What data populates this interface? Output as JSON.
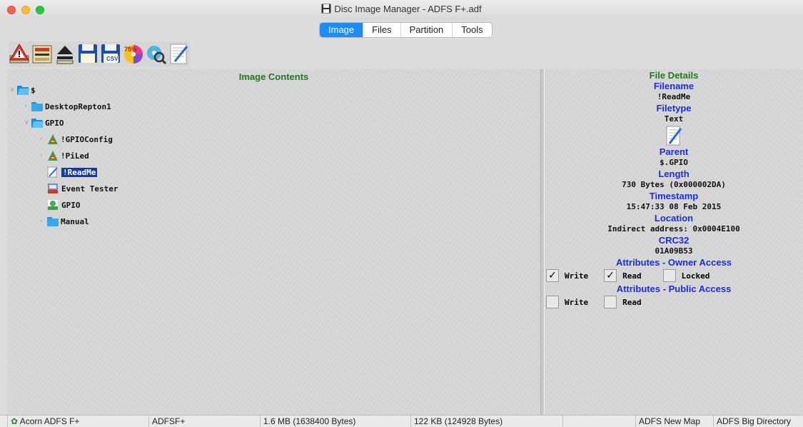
{
  "window": {
    "title": "Disc Image Manager - ADFS F+.adf"
  },
  "tabs": [
    {
      "label": "Image",
      "active": true
    },
    {
      "label": "Files",
      "active": false
    },
    {
      "label": "Partition",
      "active": false
    },
    {
      "label": "Tools",
      "active": false
    }
  ],
  "toolbar": {
    "icons": [
      "warning-disc-icon",
      "floppy-drive-icon",
      "eject-icon",
      "save-icon",
      "save-csv-icon",
      "disc-75-percent-icon",
      "disc-search-icon",
      "text-file-icon"
    ],
    "csv_badge": "CSV",
    "percent_badge": "75%"
  },
  "image_contents": {
    "title": "Image Contents",
    "tree": [
      {
        "label": "$",
        "icon": "folder-icon",
        "expanded": true
      },
      {
        "label": "DesktopRepton1",
        "icon": "folder-icon",
        "expanded": false
      },
      {
        "label": "GPIO",
        "icon": "folder-icon",
        "expanded": true
      },
      {
        "label": "!GPIOConfig",
        "icon": "acorn-app-icon",
        "expanded": false
      },
      {
        "label": "!PiLed",
        "icon": "acorn-app-icon",
        "expanded": false
      },
      {
        "label": "!ReadMe",
        "icon": "text-file-icon",
        "selected": true
      },
      {
        "label": "Event Tester",
        "icon": "basic-file-icon"
      },
      {
        "label": "GPIO",
        "icon": "module-file-icon"
      },
      {
        "label": "Manual",
        "icon": "folder-icon",
        "expanded": false
      }
    ]
  },
  "file_details": {
    "title": "File Details",
    "filename_label": "Filename",
    "filename": "!ReadMe",
    "filetype_label": "Filetype",
    "filetype": "Text",
    "parent_label": "Parent",
    "parent": "$.GPIO",
    "length_label": "Length",
    "length": "730 Bytes (0x000002DA)",
    "timestamp_label": "Timestamp",
    "timestamp": "15:47:33 08 Feb 2015",
    "location_label": "Location",
    "location": "Indirect address: 0x0004E100",
    "crc_label": "CRC32",
    "crc": "01A09B53",
    "owner_label": "Attributes - Owner Access",
    "owner": {
      "write": "Write",
      "read": "Read",
      "locked": "Locked",
      "write_checked": true,
      "read_checked": true,
      "locked_checked": false
    },
    "public_label": "Attributes - Public Access",
    "public": {
      "write": "Write",
      "read": "Read",
      "write_checked": false,
      "read_checked": false
    },
    "check_mark": "✓"
  },
  "status": {
    "format": "Acorn ADFS F+",
    "type": "ADFSF+",
    "size": "1.6 MB (1638400 Bytes)",
    "free": "122 KB (124928 Bytes)",
    "map": "ADFS New Map",
    "directory": "ADFS Big Directory"
  }
}
